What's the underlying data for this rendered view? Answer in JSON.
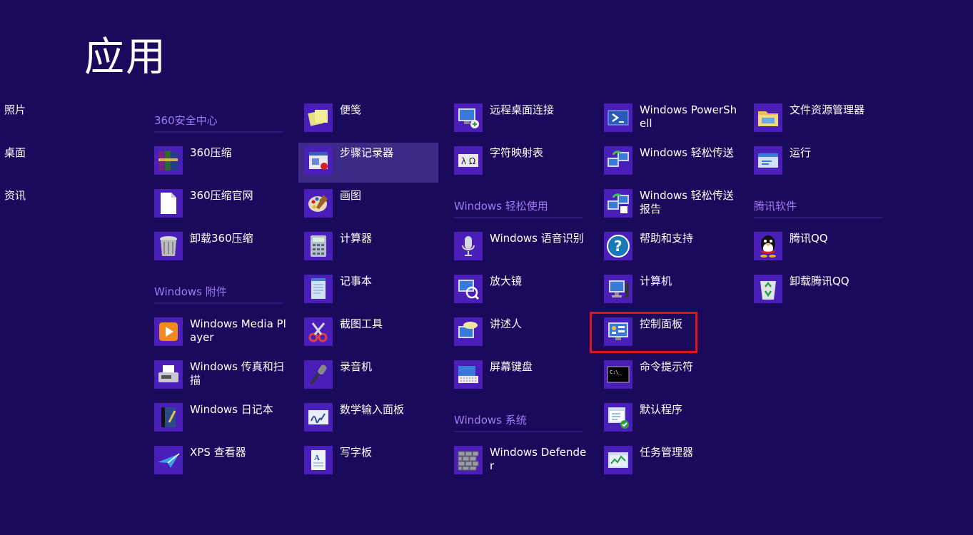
{
  "page_title": "应用",
  "left_nav": [
    "照片",
    "桌面",
    "资讯"
  ],
  "columns": [
    [
      {
        "kind": "group",
        "title": "360安全中心"
      },
      {
        "kind": "app",
        "label": "360压缩",
        "icon": "winrar-books-icon"
      },
      {
        "kind": "app",
        "label": "360压缩官网",
        "icon": "blank-document-icon"
      },
      {
        "kind": "app",
        "label": "卸载360压缩",
        "icon": "trash-bin-icon"
      },
      {
        "kind": "group",
        "title": "Windows 附件"
      },
      {
        "kind": "app",
        "label": "Windows Media Player",
        "icon": "media-player-icon"
      },
      {
        "kind": "app",
        "label": "Windows 传真和扫描",
        "icon": "fax-scanner-icon"
      },
      {
        "kind": "app",
        "label": "Windows 日记本",
        "icon": "journal-icon"
      },
      {
        "kind": "app",
        "label": "XPS 查看器",
        "icon": "xps-viewer-icon"
      }
    ],
    [
      {
        "kind": "app",
        "label": "便笺",
        "icon": "sticky-notes-icon"
      },
      {
        "kind": "app",
        "label": "步骤记录器",
        "icon": "steps-recorder-icon",
        "selected": true
      },
      {
        "kind": "app",
        "label": "画图",
        "icon": "paint-palette-icon"
      },
      {
        "kind": "app",
        "label": "计算器",
        "icon": "calculator-icon"
      },
      {
        "kind": "app",
        "label": "记事本",
        "icon": "notepad-icon"
      },
      {
        "kind": "app",
        "label": "截图工具",
        "icon": "snipping-tool-icon"
      },
      {
        "kind": "app",
        "label": "录音机",
        "icon": "microphone-icon"
      },
      {
        "kind": "app",
        "label": "数学输入面板",
        "icon": "math-input-icon"
      },
      {
        "kind": "app",
        "label": "写字板",
        "icon": "wordpad-icon"
      }
    ],
    [
      {
        "kind": "app",
        "label": "远程桌面连接",
        "icon": "remote-desktop-icon"
      },
      {
        "kind": "app",
        "label": "字符映射表",
        "icon": "character-map-icon"
      },
      {
        "kind": "group",
        "title": "Windows 轻松使用"
      },
      {
        "kind": "app",
        "label": "Windows 语音识别",
        "icon": "speech-mic-icon"
      },
      {
        "kind": "app",
        "label": "放大镜",
        "icon": "magnifier-icon"
      },
      {
        "kind": "app",
        "label": "讲述人",
        "icon": "narrator-icon"
      },
      {
        "kind": "app",
        "label": "屏幕键盘",
        "icon": "on-screen-keyboard-icon"
      },
      {
        "kind": "group",
        "title": "Windows 系统"
      },
      {
        "kind": "app",
        "label": "Windows Defender",
        "icon": "defender-wall-icon"
      }
    ],
    [
      {
        "kind": "app",
        "label": "Windows PowerShell",
        "icon": "powershell-icon"
      },
      {
        "kind": "app",
        "label": "Windows 轻松传送",
        "icon": "easy-transfer-icon"
      },
      {
        "kind": "app",
        "label": "Windows 轻松传送报告",
        "icon": "easy-transfer-report-icon"
      },
      {
        "kind": "app",
        "label": "帮助和支持",
        "icon": "help-question-icon"
      },
      {
        "kind": "app",
        "label": "计算机",
        "icon": "computer-icon"
      },
      {
        "kind": "app",
        "label": "控制面板",
        "icon": "control-panel-icon"
      },
      {
        "kind": "app",
        "label": "命令提示符",
        "icon": "command-prompt-icon"
      },
      {
        "kind": "app",
        "label": "默认程序",
        "icon": "default-programs-icon"
      },
      {
        "kind": "app",
        "label": "任务管理器",
        "icon": "task-manager-icon"
      }
    ],
    [
      {
        "kind": "app",
        "label": "文件资源管理器",
        "icon": "file-explorer-icon"
      },
      {
        "kind": "app",
        "label": "运行",
        "icon": "run-icon"
      },
      {
        "kind": "group",
        "title": "腾讯软件"
      },
      {
        "kind": "app",
        "label": "腾讯QQ",
        "icon": "qq-penguin-icon"
      },
      {
        "kind": "app",
        "label": "卸载腾讯QQ",
        "icon": "recycle-bin-icon"
      }
    ]
  ],
  "colors": {
    "background": "#1b0a5c",
    "tile": "#4a1eb8",
    "group_title": "#9d7cf2",
    "selected": "#3d2a86",
    "highlight_box": "#e0141e"
  }
}
